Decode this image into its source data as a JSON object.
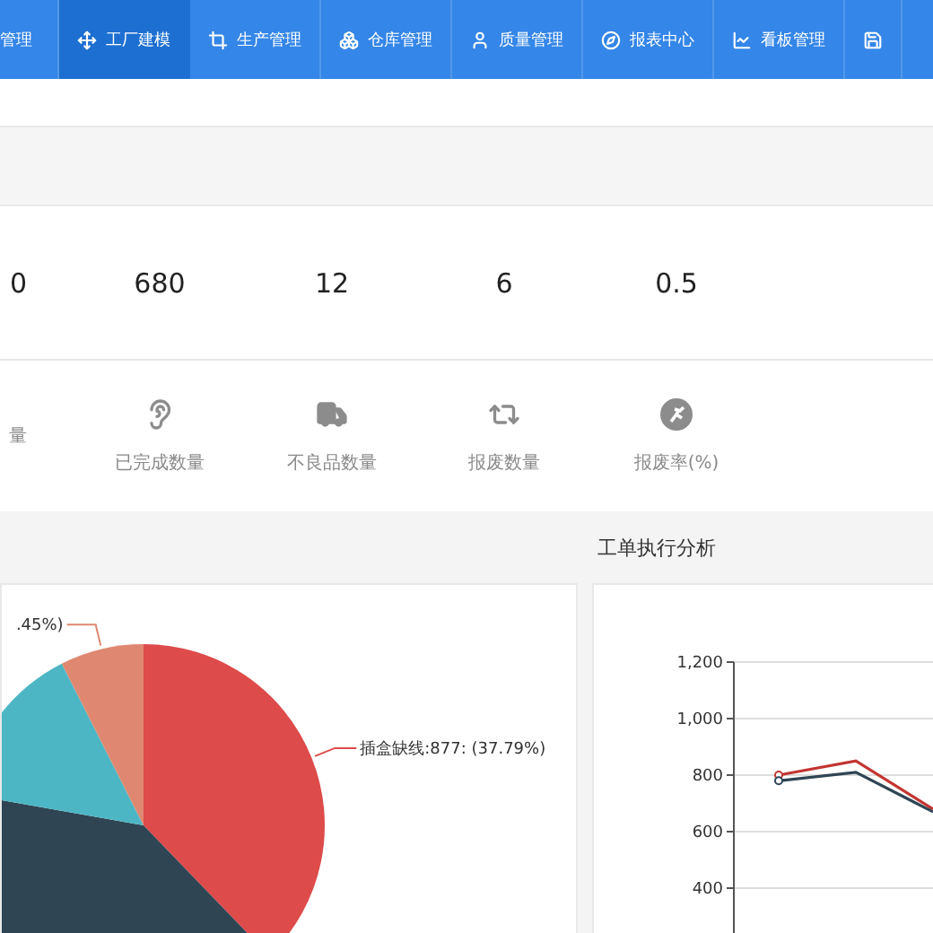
{
  "nav": {
    "items": [
      {
        "label": "管理",
        "selected": false
      },
      {
        "label": "工厂建模",
        "selected": true
      },
      {
        "label": "生产管理",
        "selected": false
      },
      {
        "label": "仓库管理",
        "selected": false
      },
      {
        "label": "质量管理",
        "selected": false
      },
      {
        "label": "报表中心",
        "selected": false
      },
      {
        "label": "看板管理",
        "selected": false
      },
      {
        "selected": false
      }
    ]
  },
  "stats": [
    {
      "value": "0",
      "label": "量"
    },
    {
      "value": "680",
      "label": "已完成数量"
    },
    {
      "value": "12",
      "label": "不良品数量"
    },
    {
      "value": "6",
      "label": "报废数量"
    },
    {
      "value": "0.5",
      "label": "报废率(%)"
    }
  ],
  "pie_panel": {
    "chart_data": {
      "type": "pie",
      "values": [
        37.79,
        40.0,
        14.76,
        7.45
      ]
    },
    "slice_labels": [
      "插盒缺线:877: (37.79%)",
      ".45%)"
    ]
  },
  "line_panel": {
    "title": "工单执行分析",
    "chart_data": {
      "type": "line",
      "grid": true,
      "yticks": [
        {
          "value": 400,
          "label": "400"
        },
        {
          "value": 600,
          "label": "600"
        },
        {
          "value": 800,
          "label": "800"
        },
        {
          "value": 1000,
          "label": "1,000"
        },
        {
          "value": 1200,
          "label": "1,200"
        }
      ],
      "ylim": [
        200,
        1200
      ],
      "series": [
        {
          "color": "#c23531",
          "values": [
            800,
            850,
            680
          ]
        },
        {
          "color": "#2f4554",
          "values": [
            780,
            810,
            670
          ]
        }
      ]
    }
  }
}
